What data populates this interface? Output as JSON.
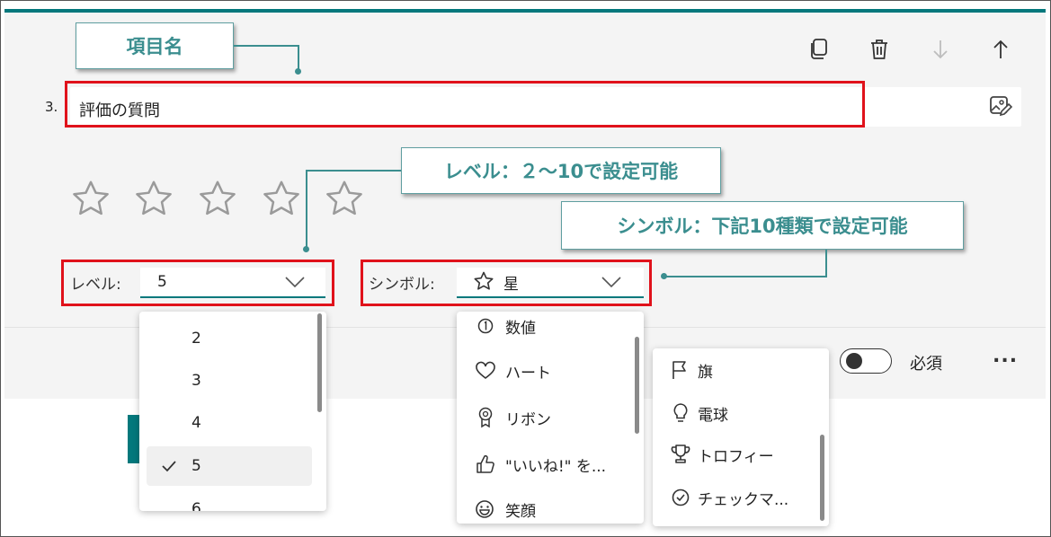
{
  "question": {
    "number": "3.",
    "title": "評価の質問"
  },
  "toolbar": {
    "copy_icon": "copy-icon",
    "delete_icon": "trash-icon",
    "move_down_icon": "arrow-down-icon",
    "move_up_icon": "arrow-up-icon",
    "edit_icon": "image-edit-icon"
  },
  "callouts": {
    "item_name": "項目名",
    "level": "レベル：２～10で設定可能",
    "symbol": "シンボル：下記10種類で設定可能"
  },
  "rating": {
    "stars": 5
  },
  "level": {
    "label": "レベル:",
    "value": "5",
    "options": [
      {
        "label": "2",
        "selected": false
      },
      {
        "label": "3",
        "selected": false
      },
      {
        "label": "4",
        "selected": false
      },
      {
        "label": "5",
        "selected": true
      },
      {
        "label": "6",
        "selected": false
      }
    ]
  },
  "symbol": {
    "label": "シンボル:",
    "value": "星",
    "options_col1": [
      {
        "label": "数値",
        "icon": "number-icon"
      },
      {
        "label": "ハート",
        "icon": "heart-icon"
      },
      {
        "label": "リボン",
        "icon": "ribbon-icon"
      },
      {
        "label": "\"いいね!\" を...",
        "icon": "thumbs-up-icon"
      },
      {
        "label": "笑顔",
        "icon": "smile-icon"
      }
    ],
    "options_col2": [
      {
        "label": "旗",
        "icon": "flag-icon"
      },
      {
        "label": "電球",
        "icon": "lightbulb-icon"
      },
      {
        "label": "トロフィー",
        "icon": "trophy-icon"
      },
      {
        "label": "チェックマ...",
        "icon": "checkmark-icon"
      }
    ]
  },
  "footer": {
    "required_label": "必須",
    "more": "..."
  },
  "colors": {
    "accent": "#03787c",
    "callout_text": "#3b8e8f",
    "highlight_red": "#e0121b"
  }
}
